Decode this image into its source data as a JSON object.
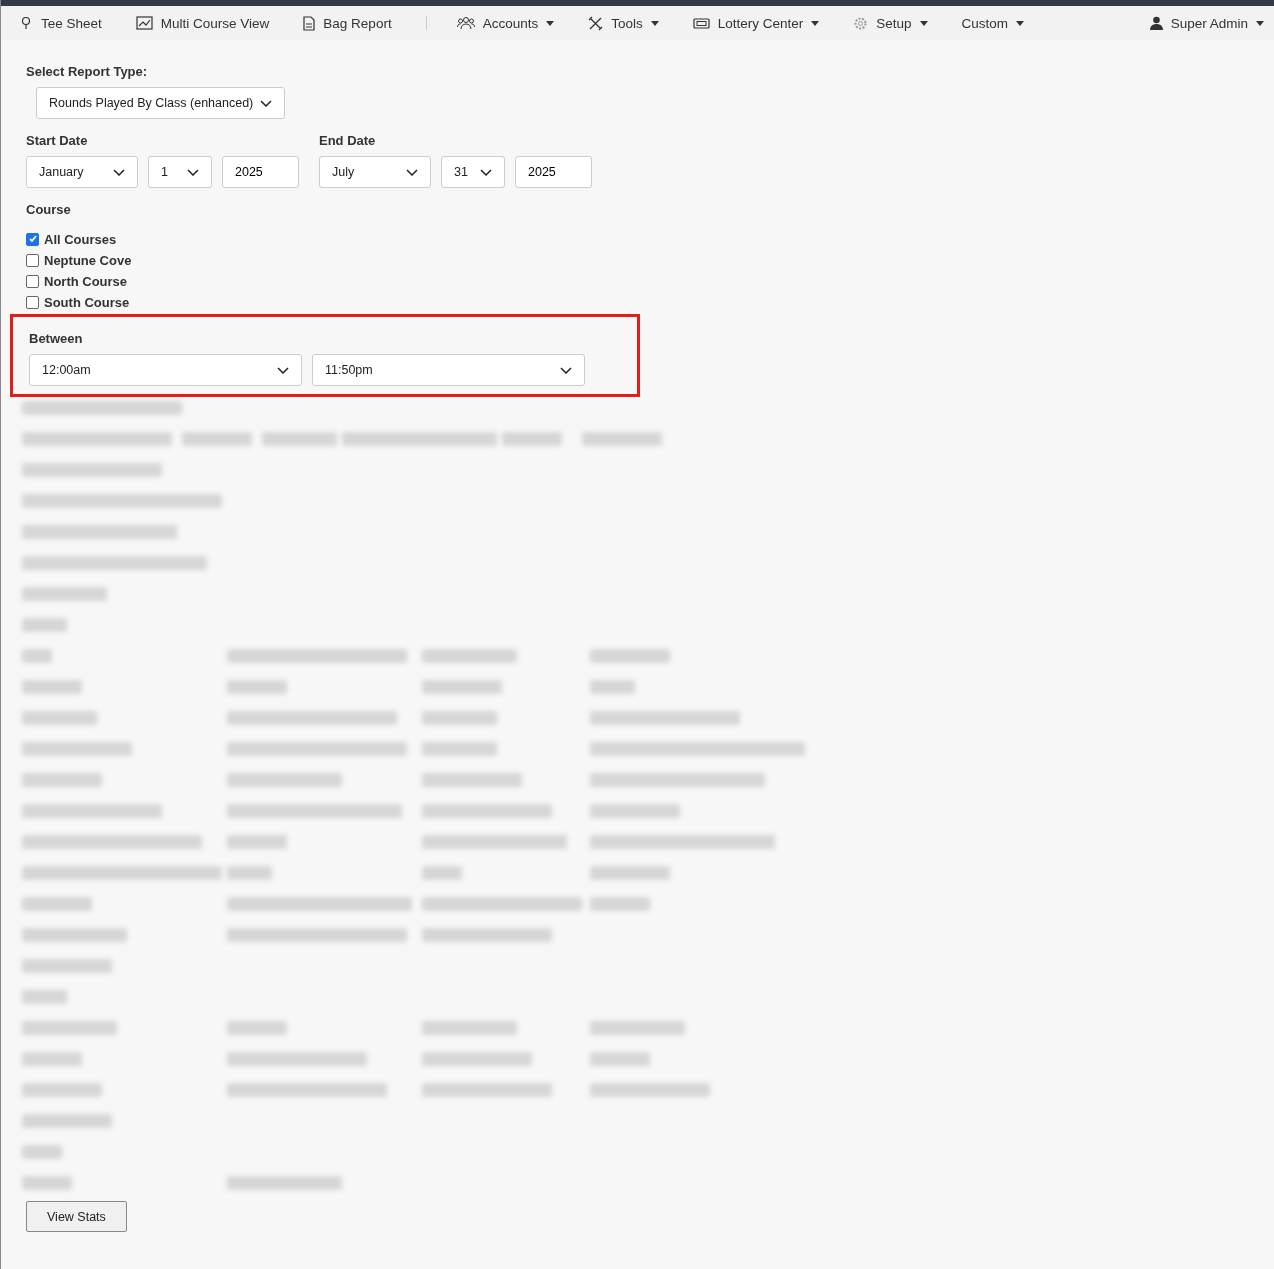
{
  "nav": {
    "items": [
      {
        "label": "Tee Sheet",
        "kind": "link"
      },
      {
        "label": "Multi Course View",
        "kind": "link"
      },
      {
        "label": "Bag Report",
        "kind": "link"
      },
      {
        "label": "Accounts",
        "kind": "menu"
      },
      {
        "label": "Tools",
        "kind": "menu"
      },
      {
        "label": "Lottery Center",
        "kind": "menu"
      },
      {
        "label": "Setup",
        "kind": "menu"
      },
      {
        "label": "Custom",
        "kind": "menu"
      }
    ],
    "user": {
      "label": "Super Admin",
      "kind": "menu"
    }
  },
  "report_type": {
    "label": "Select Report Type:",
    "value": "Rounds Played By Class (enhanced)"
  },
  "start_date": {
    "label": "Start Date",
    "month": "January",
    "day": "1",
    "year": "2025"
  },
  "end_date": {
    "label": "End Date",
    "month": "July",
    "day": "31",
    "year": "2025"
  },
  "course": {
    "label": "Course",
    "options": [
      {
        "label": "All Courses",
        "checked": true
      },
      {
        "label": "Neptune Cove",
        "checked": false
      },
      {
        "label": "North Course",
        "checked": false
      },
      {
        "label": "South Course",
        "checked": false
      }
    ]
  },
  "between": {
    "label": "Between",
    "from": "12:00am",
    "to": "11:50pm"
  },
  "submit": "View Stats"
}
